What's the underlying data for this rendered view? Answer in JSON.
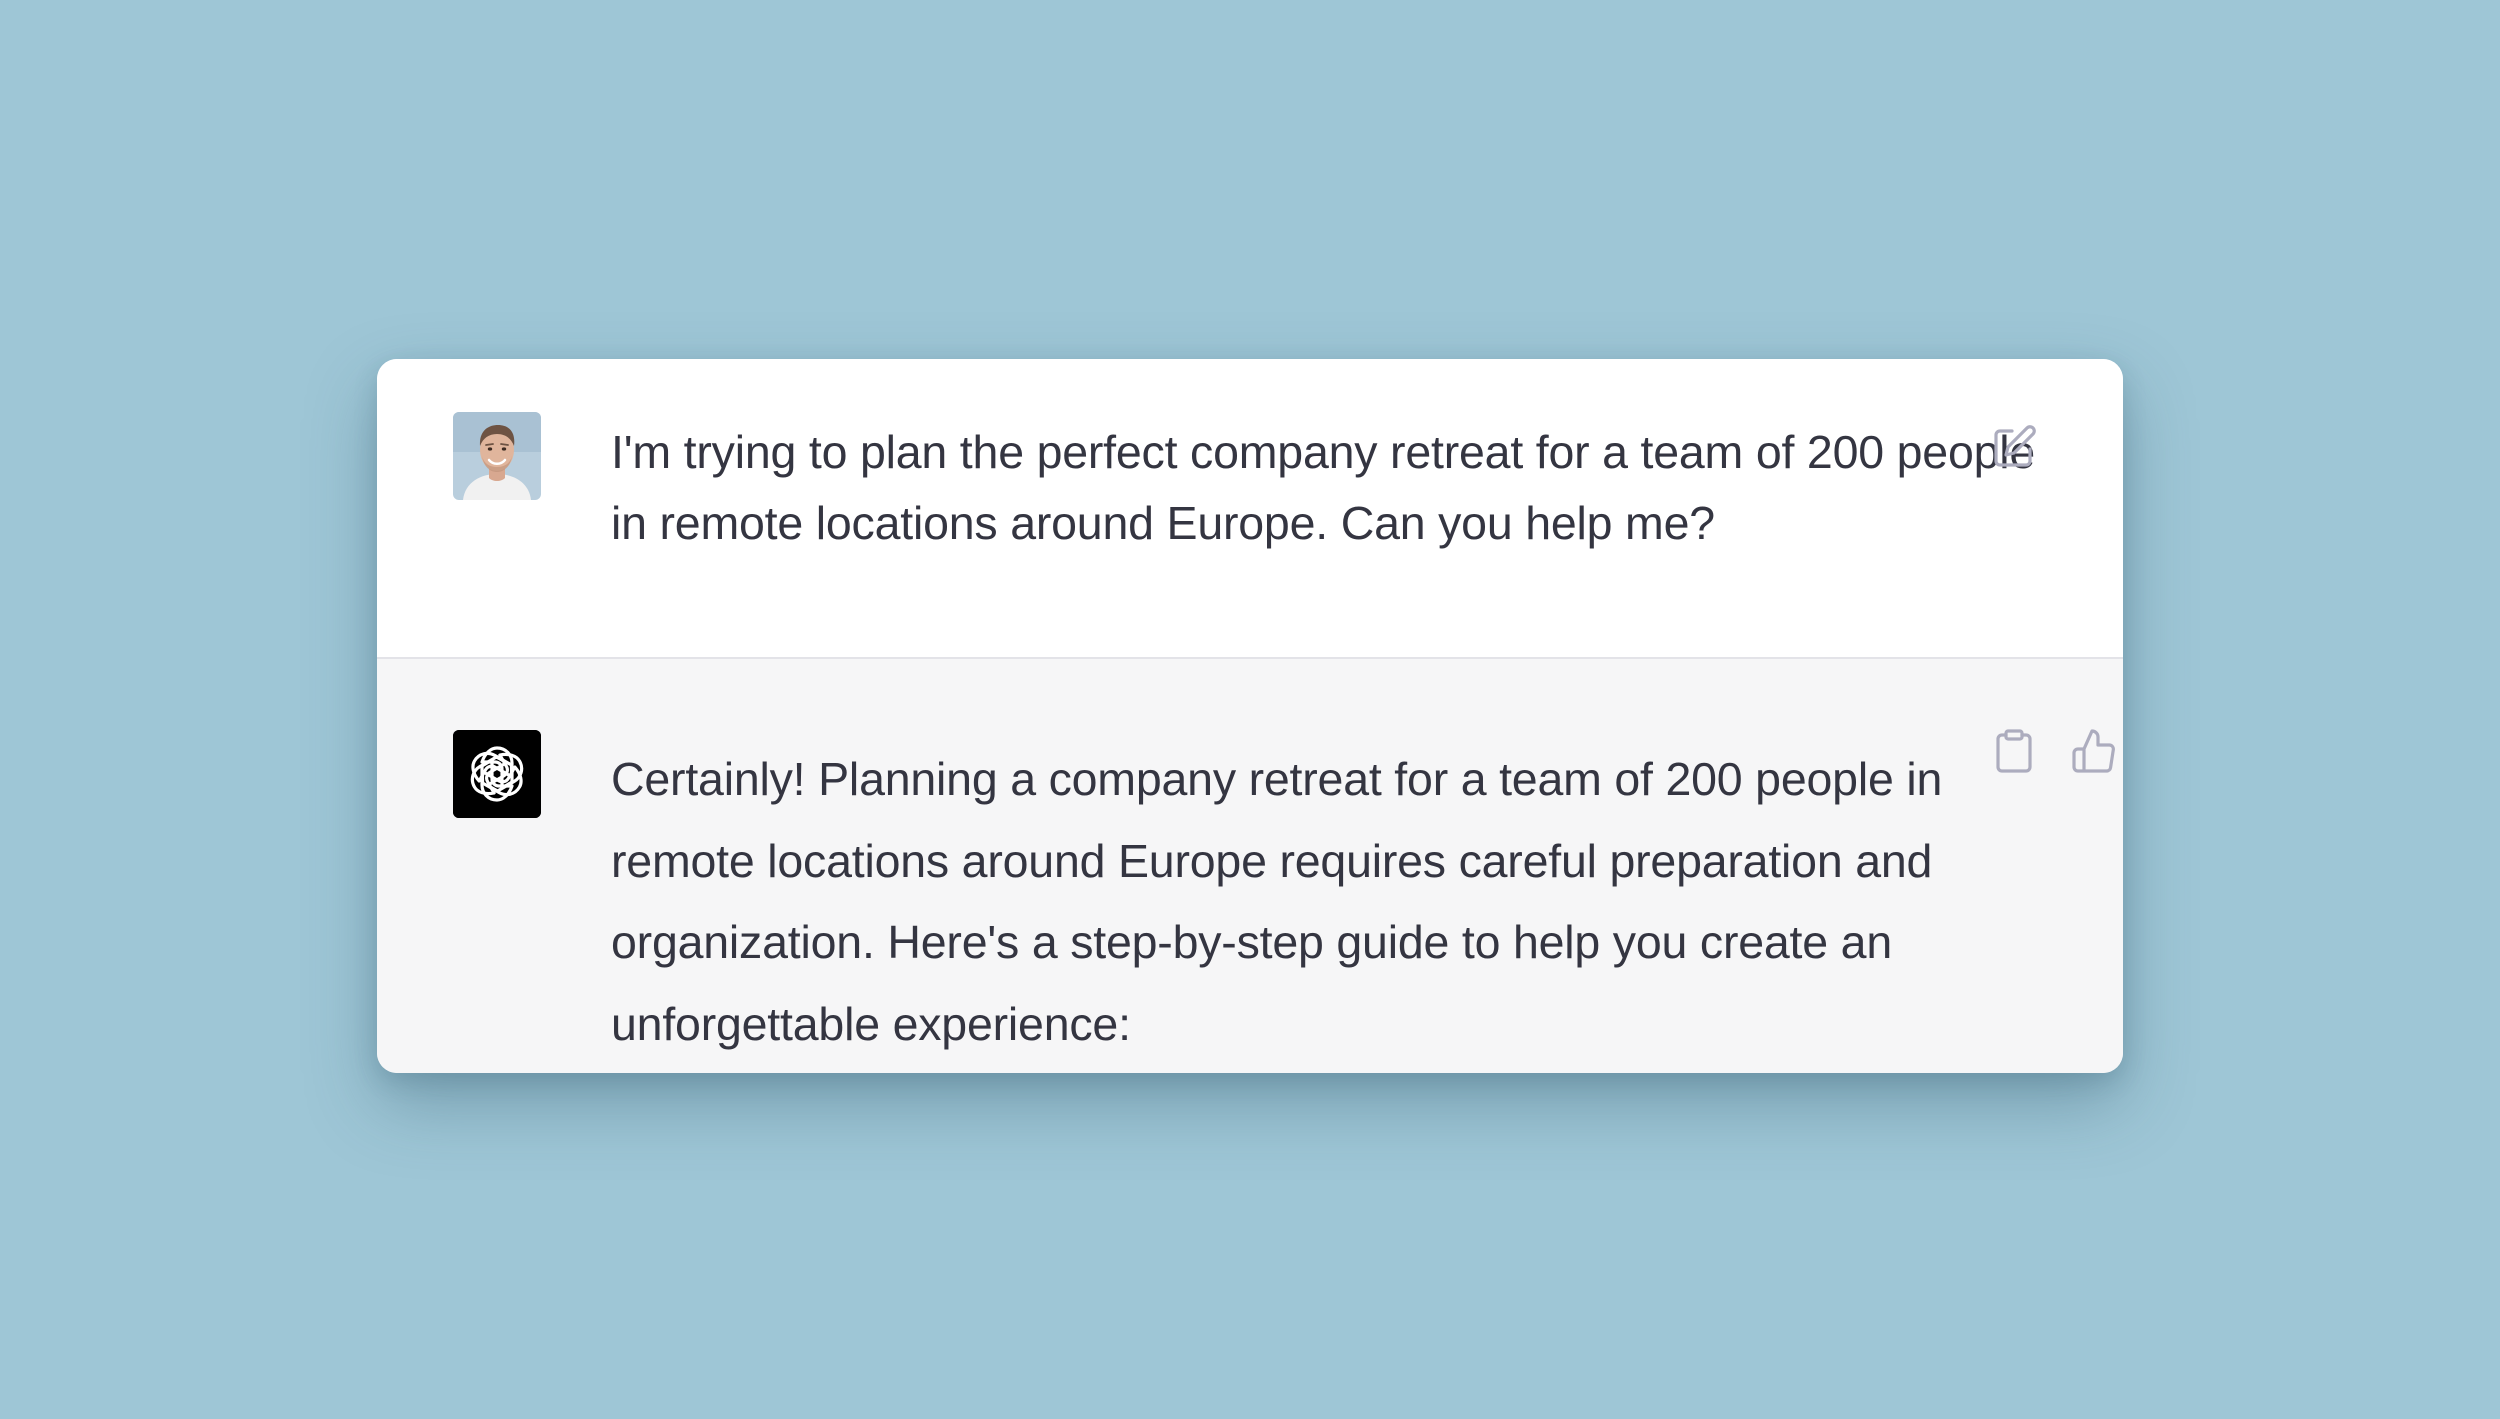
{
  "conversation": {
    "user_message": {
      "avatar_icon": "user-photo-avatar",
      "text": "I'm trying to plan the perfect company retreat for a team of 200 people in remote locations around Europe. Can you help me?",
      "actions": {
        "edit_icon": "pencil-square-icon"
      }
    },
    "assistant_message": {
      "avatar_icon": "openai-logo-icon",
      "text": "Certainly! Planning a company retreat for a team of 200 people in remote locations around Europe requires careful preparation and organization. Here's a step-by-step guide to help you create an unforgettable experience:",
      "actions": {
        "copy_icon": "clipboard-icon",
        "like_icon": "thumbs-up-icon"
      }
    }
  },
  "colors": {
    "page_background": "#9ec6d6",
    "user_row_background": "#ffffff",
    "assistant_row_background": "#f6f6f7",
    "text": "#343541",
    "icon": "#acacbe"
  }
}
